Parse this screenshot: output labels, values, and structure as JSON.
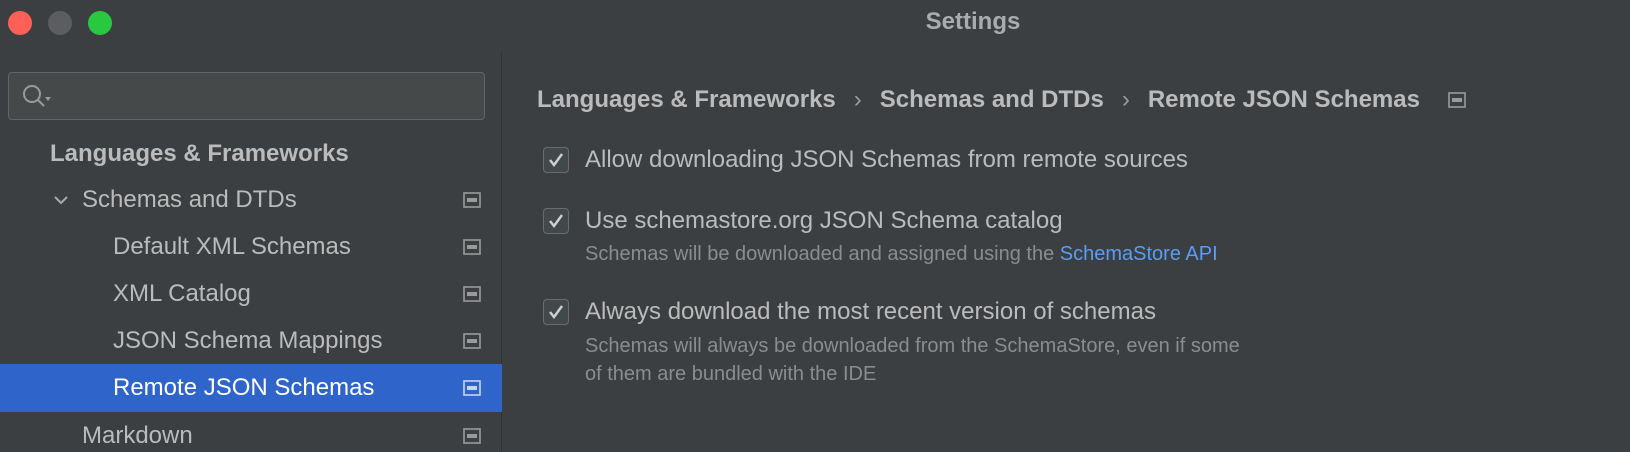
{
  "window": {
    "title": "Settings"
  },
  "search": {
    "placeholder": ""
  },
  "sidebar": {
    "items": [
      {
        "label": "Languages & Frameworks"
      },
      {
        "label": "Schemas and DTDs"
      },
      {
        "label": "Default XML Schemas"
      },
      {
        "label": "XML Catalog"
      },
      {
        "label": "JSON Schema Mappings"
      },
      {
        "label": "Remote JSON Schemas"
      },
      {
        "label": "Markdown"
      }
    ]
  },
  "breadcrumb": {
    "items": [
      "Languages & Frameworks",
      "Schemas and DTDs",
      "Remote JSON Schemas"
    ],
    "separator": "›"
  },
  "options": {
    "allow_remote": {
      "label": "Allow downloading JSON Schemas from remote sources",
      "checked": true
    },
    "schemastore": {
      "label": "Use schemastore.org JSON Schema catalog",
      "checked": true,
      "desc_prefix": "Schemas will be downloaded and assigned using the ",
      "desc_link": "SchemaStore API"
    },
    "recent": {
      "label": "Always download the most recent version of schemas",
      "checked": true,
      "desc_line1": "Schemas will always be downloaded from the SchemaStore, even if some",
      "desc_line2": "of them are bundled with the IDE"
    }
  },
  "colors": {
    "accent": "#2f65ca",
    "link": "#589df6",
    "background": "#3c3f41"
  }
}
